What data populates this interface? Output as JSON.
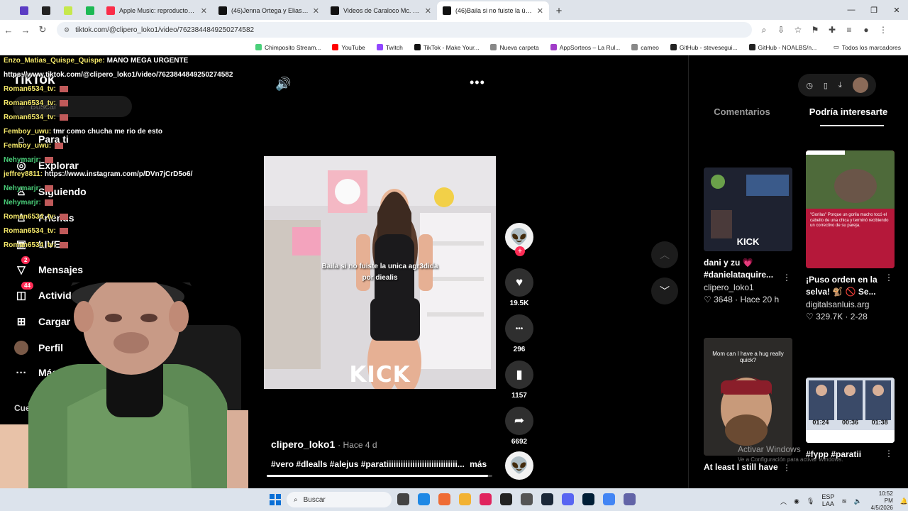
{
  "browser": {
    "tabs": [
      {
        "title": "",
        "active": false,
        "color": "#5b3cc4",
        "small": true
      },
      {
        "title": "",
        "active": false,
        "color": "#222222",
        "small": true
      },
      {
        "title": "",
        "active": false,
        "color": "#c6e84c",
        "small": true
      },
      {
        "title": "",
        "active": false,
        "color": "#1db954",
        "small": true
      },
      {
        "title": "Apple Music: reproductor web",
        "active": false,
        "color": "#fa2d48",
        "small": false
      },
      {
        "title": "(46)Jenna Ortega y Elias Rønne",
        "active": false,
        "color": "#111111",
        "small": false
      },
      {
        "title": "Videos de Caraloco Mc. (@cara",
        "active": false,
        "color": "#111111",
        "small": false
      },
      {
        "title": "(46)Baila si no fuiste la única ag",
        "active": true,
        "color": "#111111",
        "small": false
      }
    ],
    "url": "tiktok.com/@clipero_loko1/video/7623844849250274582",
    "bookmarks": [
      {
        "label": "Chimposito Stream...",
        "color": "#4ad07a"
      },
      {
        "label": "YouTube",
        "color": "#ff0000"
      },
      {
        "label": "Twitch",
        "color": "#9146ff"
      },
      {
        "label": "TikTok - Make Your...",
        "color": "#111111"
      },
      {
        "label": "Nueva carpeta",
        "color": "#888888"
      },
      {
        "label": "AppSorteos – La Rul...",
        "color": "#a03cc8"
      },
      {
        "label": "cameo",
        "color": "#888888"
      },
      {
        "label": "GitHub - stevesegui...",
        "color": "#222222"
      },
      {
        "label": "GitHub - NOALBS/n...",
        "color": "#222222"
      }
    ],
    "all_bookmarks": "Todos los marcadores"
  },
  "tiktok": {
    "logo": "TikTok",
    "search_placeholder": "Buscar",
    "nav": [
      {
        "label": "Para ti",
        "icon": "⌂"
      },
      {
        "label": "Explorar",
        "icon": "◎"
      },
      {
        "label": "Siguiendo",
        "icon": "♙"
      },
      {
        "label": "Friends",
        "icon": "♙"
      },
      {
        "label": "LIVE",
        "icon": "▣"
      },
      {
        "label": "Mensajes",
        "icon": "▽",
        "badge": "2"
      },
      {
        "label": "Actividad",
        "icon": "◫",
        "badge": "44"
      },
      {
        "label": "Cargar",
        "icon": "⊞"
      },
      {
        "label": "Perfil",
        "icon": ""
      },
      {
        "label": "Más",
        "icon": "···"
      }
    ],
    "following_header": "Cuentas que sigues",
    "video": {
      "caption_line1": "Baila si no fuiste la unica agr3dida",
      "caption_line2": "por diealis",
      "watermark": "KICK",
      "author": "clipero_loko1",
      "time_ago": "· Hace 4 d",
      "description": "#vero #dlealls #alejus #paratiiiiiiiiiiiiiiiiiiiiiiiiiiiiii...",
      "more_label": "más",
      "progress": 0.98
    },
    "actions": [
      {
        "name": "like",
        "icon": "♥",
        "count": "19.5K"
      },
      {
        "name": "comment",
        "icon": "•••",
        "count": "296"
      },
      {
        "name": "bookmark",
        "icon": "▮",
        "count": "1157"
      },
      {
        "name": "share",
        "icon": "➦",
        "count": "6692"
      }
    ],
    "panel": {
      "tab_comments": "Comentarios",
      "tab_suggest": "Podría interesarte",
      "cards": [
        {
          "title": "dani y zu 💗",
          "title2": "#danielataquire...",
          "user": "clipero_loko1",
          "stats": "♡ 3648 · Hace 20 h",
          "thumb_label": "KICK"
        },
        {
          "title": "¡Puso orden en la",
          "title2": "selva! 🐒 🚫 Se...",
          "user": "digitalsanluis.arg",
          "stats": "♡ 329.7K · 2-28",
          "thumb_label": "\"Gorilas\" Porque un gorila macho tocó el cabello de una chica y terminó recibiendo un correctivo de su pareja."
        },
        {
          "title": "At least I still have",
          "title2": "",
          "user": "",
          "stats": "",
          "thumb_label": "Mom can I have a hug really quick?"
        },
        {
          "title": "#fypp #paratii",
          "title2": "",
          "user": "",
          "stats": "",
          "thumb_label": ""
        }
      ],
      "news_times": [
        "01:24",
        "00:36",
        "01:38"
      ]
    }
  },
  "chat": {
    "messages": [
      {
        "user": "Enzo_Matias_Quispe_Quispe:",
        "text": "MANO MEGA URGENTE",
        "green": false
      },
      {
        "user": "",
        "text": "https://www.tiktok.com/@clipero_loko1/video/7623844849250274582",
        "green": false
      },
      {
        "user": "Roman6534_tv:",
        "text": "",
        "green": false,
        "emote": true
      },
      {
        "user": "Roman6534_tv:",
        "text": "",
        "green": false,
        "emote": true
      },
      {
        "user": "Roman6534_tv:",
        "text": "",
        "green": false,
        "emote": true
      },
      {
        "user": "Femboy_uwu:",
        "text": "tmr como chucha me rio de esto",
        "green": false
      },
      {
        "user": "Femboy_uwu:",
        "text": "",
        "green": false,
        "emote": true
      },
      {
        "user": "Nehymarjr:",
        "text": "",
        "green": true,
        "emote": true
      },
      {
        "user": "jeffrey8811:",
        "text": "https://www.instagram.com/p/DVn7jCrD5o6/",
        "green": false
      },
      {
        "user": "Nehymarjr:",
        "text": "",
        "green": true,
        "emote": true
      },
      {
        "user": "Nehymarjr:",
        "text": "",
        "green": true,
        "emote": true
      },
      {
        "user": "Roman6534_tv:",
        "text": "",
        "green": false,
        "emote": true
      },
      {
        "user": "Roman6534_tv:",
        "text": "",
        "green": false,
        "emote": true
      },
      {
        "user": "Roman6534_tv:",
        "text": "",
        "green": false,
        "emote": true
      }
    ]
  },
  "windows": {
    "activate_title": "Activar Windows",
    "activate_sub": "Ve a Configuración para activar Windows.",
    "taskbar_search": "Buscar",
    "lang": "ESP",
    "lang2": "LAA",
    "time": "10:52 PM",
    "date": "4/5/2026",
    "app_colors": [
      "#444444",
      "#1e88e5",
      "#ef6c35",
      "#f2b233",
      "#e0245e",
      "#222222",
      "#555555",
      "#1b2838",
      "#5865f2",
      "#001e36",
      "#4285f4",
      "#6264a7"
    ]
  }
}
